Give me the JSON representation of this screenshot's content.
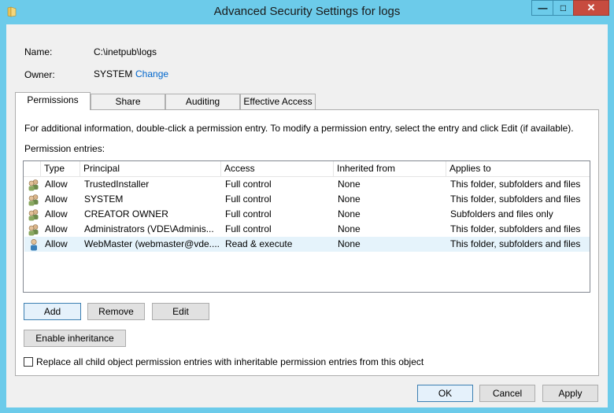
{
  "window": {
    "title": "Advanced Security Settings for logs",
    "min_glyph": "—",
    "max_glyph": "□",
    "close_glyph": "✕"
  },
  "name_label": "Name:",
  "name_value": "C:\\inetpub\\logs",
  "owner_label": "Owner:",
  "owner_value": "SYSTEM",
  "owner_change": "Change",
  "tabs": [
    {
      "label": "Permissions",
      "active": true
    },
    {
      "label": "Share",
      "active": false
    },
    {
      "label": "Auditing",
      "active": false
    },
    {
      "label": "Effective Access",
      "active": false
    }
  ],
  "info_text": "For additional information, double-click a permission entry. To modify a permission entry, select the entry and click Edit (if available).",
  "entries_label": "Permission entries:",
  "columns": [
    "Type",
    "Principal",
    "Access",
    "Inherited from",
    "Applies to"
  ],
  "rows": [
    {
      "icon": "group-icon",
      "type": "Allow",
      "principal": "TrustedInstaller",
      "access": "Full control",
      "inherited": "None",
      "applies": "This folder, subfolders and files"
    },
    {
      "icon": "group-icon",
      "type": "Allow",
      "principal": "SYSTEM",
      "access": "Full control",
      "inherited": "None",
      "applies": "This folder, subfolders and files"
    },
    {
      "icon": "group-icon",
      "type": "Allow",
      "principal": "CREATOR OWNER",
      "access": "Full control",
      "inherited": "None",
      "applies": "Subfolders and files only"
    },
    {
      "icon": "group-icon",
      "type": "Allow",
      "principal": "Administrators (VDE\\Adminis...",
      "access": "Full control",
      "inherited": "None",
      "applies": "This folder, subfolders and files"
    },
    {
      "icon": "user-icon",
      "type": "Allow",
      "principal": "WebMaster (webmaster@vde....",
      "access": "Read & execute",
      "inherited": "None",
      "applies": "This folder, subfolders and files",
      "selected": true
    }
  ],
  "buttons": {
    "add": "Add",
    "remove": "Remove",
    "edit": "Edit",
    "enable_inheritance": "Enable inheritance",
    "ok": "OK",
    "cancel": "Cancel",
    "apply": "Apply"
  },
  "replace_checkbox_label": "Replace all child object permission entries with inheritable permission entries from this object",
  "replace_checked": false,
  "colors": {
    "titlebar": "#6ccbea",
    "close": "#c74b3f",
    "link": "#0066cc",
    "selected_row": "#e5f3fb"
  }
}
